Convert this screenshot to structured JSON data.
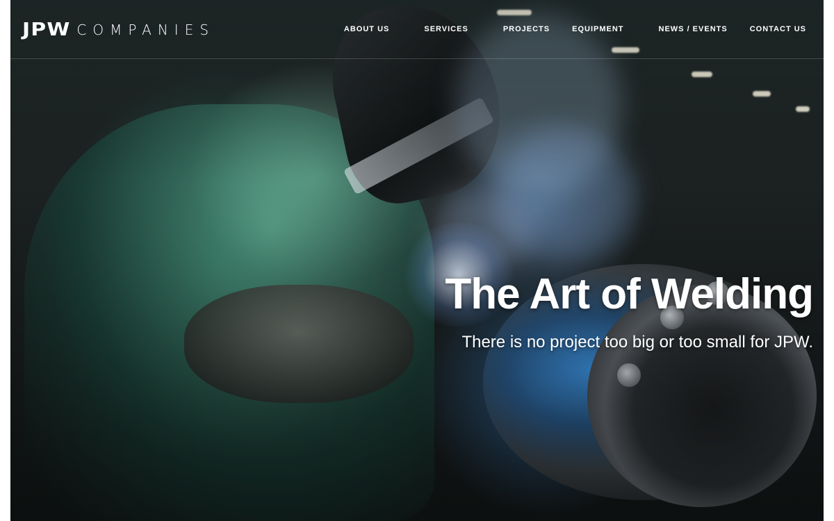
{
  "brand": {
    "logo_mark": "JPW",
    "logo_word": "COMPANIES"
  },
  "nav": {
    "items": [
      {
        "label": "ABOUT US"
      },
      {
        "label": "SERVICES"
      },
      {
        "label": "PROJECTS"
      },
      {
        "label": "EQUIPMENT"
      },
      {
        "label": "NEWS / EVENTS"
      },
      {
        "label": "CONTACT US"
      }
    ]
  },
  "hero": {
    "title": "The Art of Welding",
    "subtitle": "There is no project too big or too small for JPW.",
    "image_subject": "welder-photo"
  },
  "colors": {
    "nav_text": "#ffffff",
    "hero_text": "#ffffff",
    "header_divider": "rgba(255,255,255,0.18)"
  }
}
